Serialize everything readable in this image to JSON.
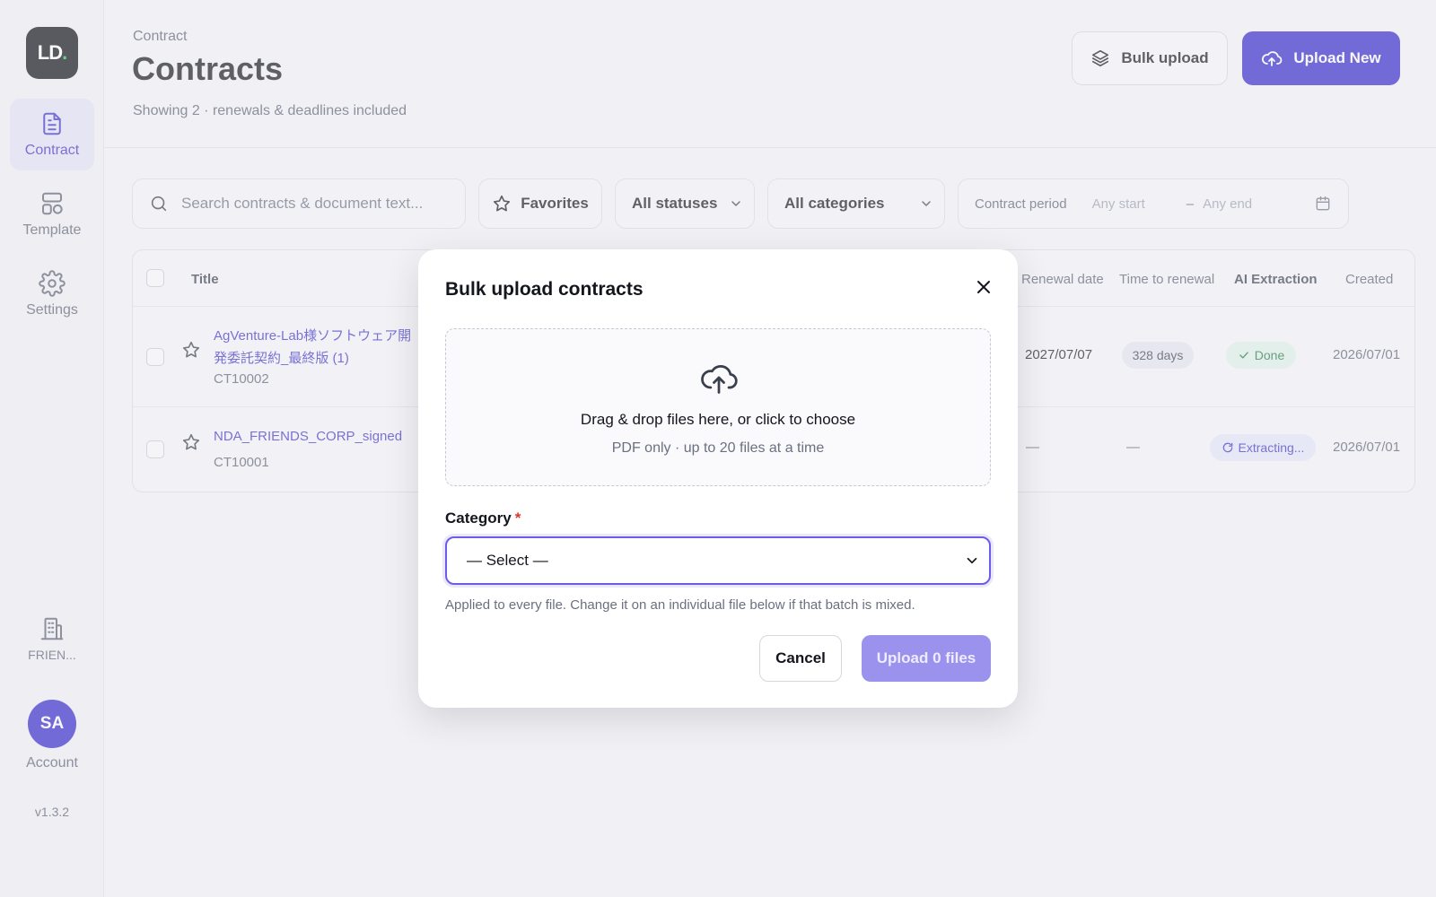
{
  "app": {
    "logo_text": "LD",
    "logo_dot": ".",
    "accent_color": "#3126c9",
    "version": "v1.3.2"
  },
  "sidebar": {
    "items": [
      {
        "label": "Contract",
        "icon": "document-icon",
        "active": true
      },
      {
        "label": "Template",
        "icon": "template-icon",
        "active": false
      },
      {
        "label": "Settings",
        "icon": "gear-icon",
        "active": false
      }
    ],
    "org_label": "FRIEN...",
    "account_initials": "SA",
    "account_label": "Account"
  },
  "header": {
    "breadcrumb": "Contract",
    "title": "Contracts",
    "subtitle": "Showing 2 · renewals & deadlines included",
    "bulk_upload_label": "Bulk upload",
    "upload_new_label": "Upload New"
  },
  "filters": {
    "search_placeholder": "Search contracts & document text...",
    "favorites_label": "Favorites",
    "status_selected": "All statuses",
    "category_selected": "All categories",
    "period_label": "Contract period",
    "period_start": "Any start",
    "period_dash": "–",
    "period_end": "Any end"
  },
  "table": {
    "columns": {
      "title": "Title",
      "renewal_date": "Renewal date",
      "time_to_renewal": "Time to renewal",
      "ai_extraction": "AI Extraction",
      "created": "Created"
    },
    "rows": [
      {
        "title_line1": "AgVenture-Lab様ソフトウェア開",
        "title_line2": "発委託契約_最終版 (1)",
        "code": "CT10002",
        "renewal_date": "2027/07/07",
        "time_to_renewal": "328 days",
        "ai_extraction": "Done",
        "created": "2026/07/01"
      },
      {
        "title_line1": "NDA_FRIENDS_CORP_signed",
        "code": "CT10001",
        "renewal_date": "—",
        "time_to_renewal": "—",
        "ai_extraction": "Extracting...",
        "created": "2026/07/01"
      }
    ]
  },
  "modal": {
    "title": "Bulk upload contracts",
    "dropzone_main": "Drag & drop files here, or click to choose",
    "dropzone_sub": "PDF only · up to 20 files at a time",
    "category_label": "Category",
    "required_mark": "*",
    "category_selected": "— Select —",
    "hint": "Applied to every file. Change it on an individual file below if that batch is mixed.",
    "cancel_label": "Cancel",
    "submit_label": "Upload 0 files"
  }
}
